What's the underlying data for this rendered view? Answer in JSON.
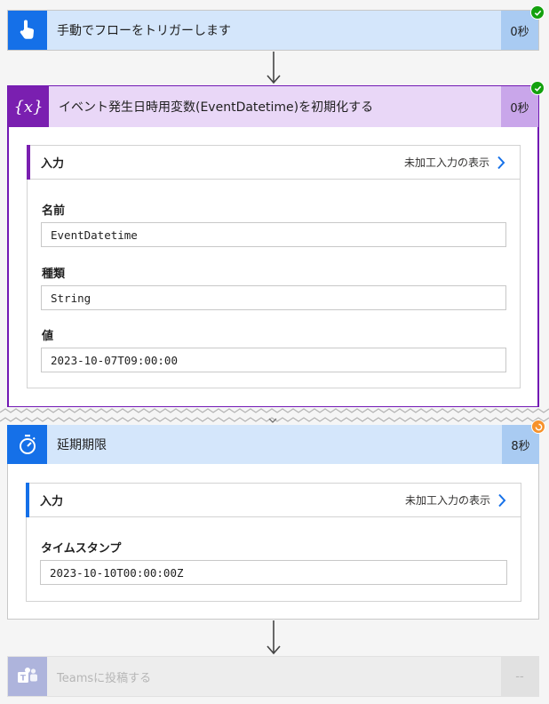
{
  "steps": {
    "trigger": {
      "title": "手動でフローをトリガーします",
      "duration": "0秒",
      "icon": "touch-hand-icon",
      "status": "success"
    },
    "init_variable": {
      "title": "イベント発生日時用変数(EventDatetime)を初期化する",
      "duration": "0秒",
      "icon": "variable-icon",
      "icon_glyph": "{x}",
      "status": "success",
      "inputs": {
        "label": "入力",
        "raw_link": "未加工入力の表示",
        "fields": [
          {
            "label": "名前",
            "value": "EventDatetime"
          },
          {
            "label": "種類",
            "value": "String"
          },
          {
            "label": "値",
            "value": "2023-10-07T09:00:00"
          }
        ]
      }
    },
    "delay": {
      "title": "延期期限",
      "duration": "8秒",
      "icon": "stopwatch-icon",
      "status": "running",
      "inputs": {
        "label": "入力",
        "raw_link": "未加工入力の表示",
        "fields": [
          {
            "label": "タイムスタンプ",
            "value": "2023-10-10T00:00:00Z"
          }
        ]
      }
    },
    "teams": {
      "title": "Teamsに投稿する",
      "duration": "--",
      "icon": "teams-icon",
      "status": "pending"
    }
  },
  "colors": {
    "trigger_accent": "#1570e8",
    "variable_accent": "#7a1fb0",
    "success": "#13a10e",
    "running": "#f7922b"
  }
}
